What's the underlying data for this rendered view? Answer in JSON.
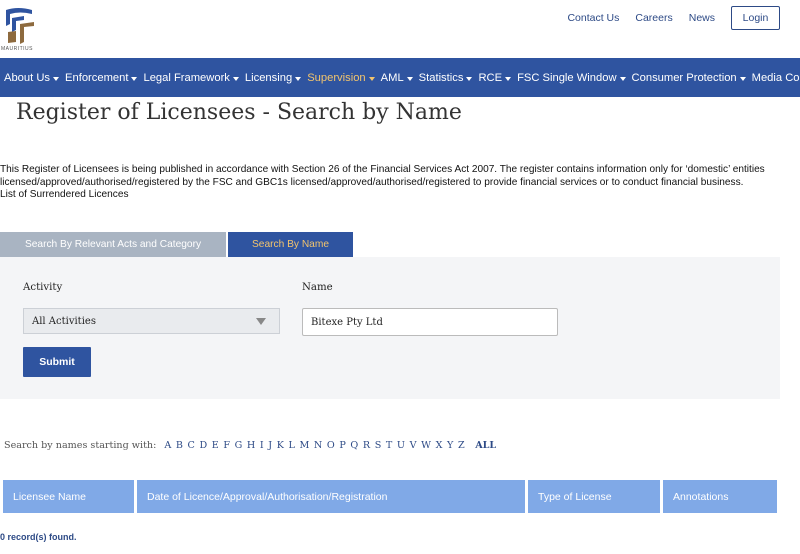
{
  "header": {
    "logo_text": "MAURITIUS",
    "links": [
      "Contact Us",
      "Careers",
      "News"
    ],
    "login_label": "Login"
  },
  "nav": {
    "items": [
      {
        "label": "About Us"
      },
      {
        "label": "Enforcement"
      },
      {
        "label": "Legal Framework"
      },
      {
        "label": "Licensing"
      },
      {
        "label": "Supervision",
        "active": true
      },
      {
        "label": "AML"
      },
      {
        "label": "Statistics"
      },
      {
        "label": "RCE"
      },
      {
        "label": "FSC Single Window"
      },
      {
        "label": "Consumer Protection"
      },
      {
        "label": "Media Corner"
      }
    ]
  },
  "page": {
    "title": "Register of Licensees - Search by Name",
    "intro_line_1": "This Register of Licensees is being published in accordance with Section 26 of the Financial Services Act 2007. The register contains information only for ‘domestic’ entities",
    "intro_line_2": "licensed/approved/authorised/registered by the FSC and GBC1s licensed/approved/authorised/registered to provide financial services or to conduct financial business.",
    "intro_line_3": "List of Surrendered Licences"
  },
  "tabs": {
    "acts_label": "Search By Relevant Acts and Category",
    "name_label": "Search By Name"
  },
  "form": {
    "activity_label": "Activity",
    "activity_value": "All Activities",
    "name_label": "Name",
    "name_value": "Bitexe Pty Ltd",
    "submit_label": "Submit"
  },
  "alphabet": {
    "label": "Search by names starting with:",
    "letters": [
      "A",
      "B",
      "C",
      "D",
      "E",
      "F",
      "G",
      "H",
      "I",
      "J",
      "K",
      "L",
      "M",
      "N",
      "O",
      "P",
      "Q",
      "R",
      "S",
      "T",
      "U",
      "V",
      "W",
      "X",
      "Y",
      "Z"
    ],
    "all_label": "ALL"
  },
  "table": {
    "headers": [
      "Licensee Name",
      "Date of Licence/Approval/Authorisation/Registration",
      "Type of License",
      "Annotations"
    ]
  },
  "results": {
    "status": "0 record(s) found."
  },
  "colors": {
    "brand_blue": "#2f54a0",
    "active_nav": "#f2c46d",
    "table_header": "#80a9e7"
  }
}
